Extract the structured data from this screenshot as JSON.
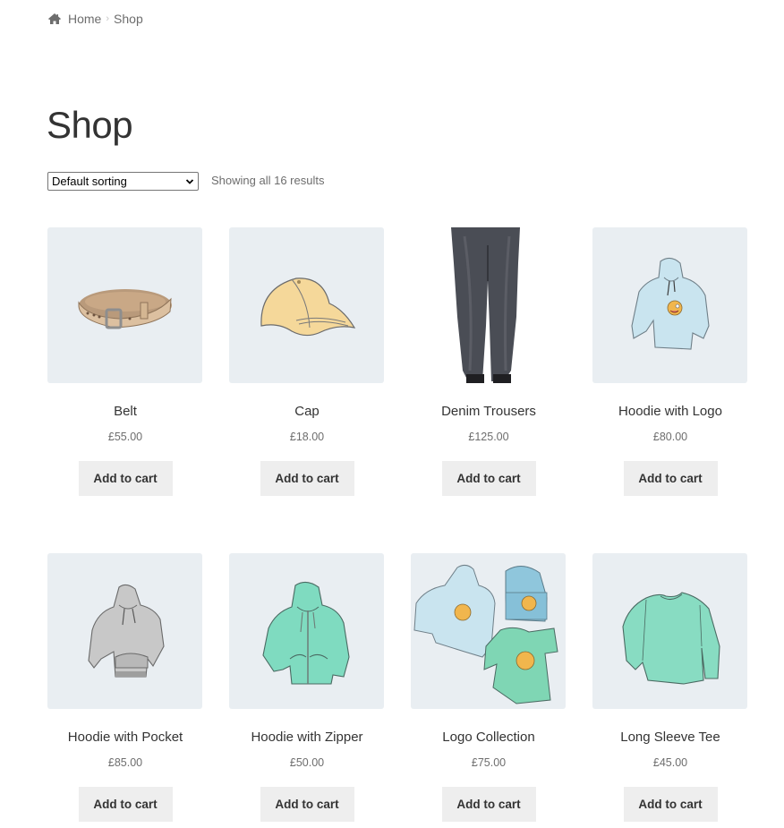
{
  "breadcrumb": {
    "icon": "home-icon",
    "items": [
      "Home",
      "Shop"
    ],
    "separator": "›"
  },
  "page": {
    "title": "Shop"
  },
  "toolbar": {
    "sort_selected": "Default sorting",
    "result_count": "Showing all 16 results"
  },
  "products": [
    {
      "name": "Belt",
      "price": "£55.00",
      "button": "Add to cart",
      "image": "belt-image"
    },
    {
      "name": "Cap",
      "price": "£18.00",
      "button": "Add to cart",
      "image": "cap-image"
    },
    {
      "name": "Denim Trousers",
      "price": "£125.00",
      "button": "Add to cart",
      "image": "denim-trousers-image"
    },
    {
      "name": "Hoodie with Logo",
      "price": "£80.00",
      "button": "Add to cart",
      "image": "hoodie-logo-image"
    },
    {
      "name": "Hoodie with Pocket",
      "price": "£85.00",
      "button": "Add to cart",
      "image": "hoodie-pocket-image"
    },
    {
      "name": "Hoodie with Zipper",
      "price": "£50.00",
      "button": "Add to cart",
      "image": "hoodie-zipper-image"
    },
    {
      "name": "Logo Collection",
      "price": "£75.00",
      "button": "Add to cart",
      "image": "logo-collection-image"
    },
    {
      "name": "Long Sleeve Tee",
      "price": "£45.00",
      "button": "Add to cart",
      "image": "long-sleeve-tee-image"
    }
  ],
  "colors": {
    "tile_bg": "#e9eef2",
    "button_bg": "#eeeeee",
    "text": "#333333",
    "muted": "#6d6d6d"
  }
}
